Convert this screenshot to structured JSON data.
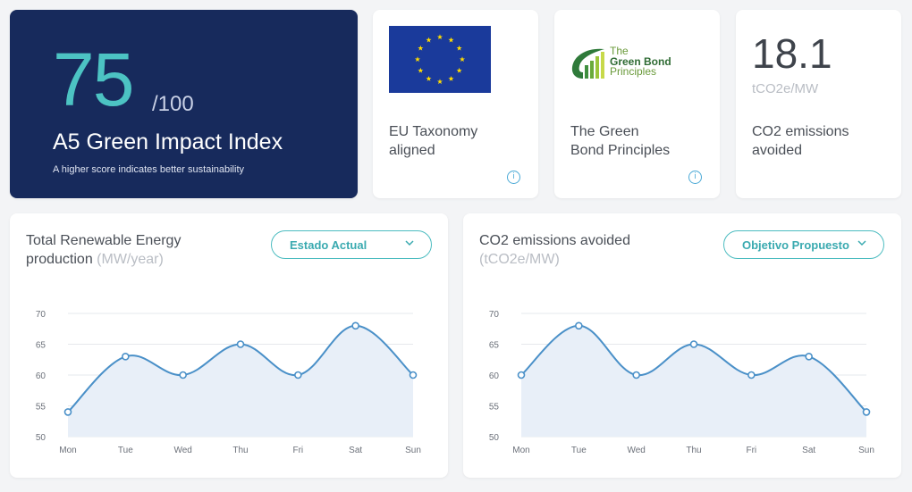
{
  "hero": {
    "score": "75",
    "out_of": "/100",
    "title": "A5 Green Impact Index",
    "subtitle": "A higher score indicates better sustainability",
    "colors": {
      "background": "#172a5c",
      "score": "#4cc3c3"
    }
  },
  "cards": {
    "eu_taxonomy": {
      "label_line1": "EU Taxonomy",
      "label_line2": "aligned",
      "icon": "eu-flag-icon",
      "info_icon": "info-icon"
    },
    "green_bond": {
      "logo_line1": "The",
      "logo_line2": "Green Bond",
      "logo_line3": "Principles",
      "label_line1": "The Green",
      "label_line2": "Bond Principles",
      "icon": "green-bond-logo",
      "info_icon": "info-icon"
    },
    "co2": {
      "value": "18.1",
      "unit": "tCO2e/MW",
      "label_line1": "CO2 emissions",
      "label_line2": "avoided"
    }
  },
  "charts": {
    "renewable": {
      "title_line1": "Total Renewable Energy",
      "title_line2": "production",
      "unit": "(MW/year)",
      "dropdown_label": "Estado Actual",
      "dropdown_icon": "chevron-down-icon"
    },
    "co2": {
      "title_line1": "CO2 emissions avoided",
      "unit": "(tCO2e/MW)",
      "dropdown_label": "Objetivo Propuesto",
      "dropdown_icon": "chevron-down-icon"
    }
  },
  "chart_data": [
    {
      "type": "area",
      "categories": [
        "Mon",
        "Tue",
        "Wed",
        "Thu",
        "Fri",
        "Sat",
        "Sun"
      ],
      "series": [
        {
          "values": [
            54,
            63,
            60,
            65,
            60,
            68,
            60
          ]
        }
      ],
      "ylim": [
        50,
        70
      ],
      "yticks": [
        "50",
        "55",
        "60",
        "65",
        "70"
      ],
      "grid": true,
      "colors": {
        "line": "#4a90c8",
        "fill": "#e8eff8"
      }
    },
    {
      "type": "area",
      "categories": [
        "Mon",
        "Tue",
        "Wed",
        "Thu",
        "Fri",
        "Sat",
        "Sun"
      ],
      "series": [
        {
          "values": [
            60,
            68,
            60,
            65,
            60,
            63,
            54
          ]
        }
      ],
      "ylim": [
        50,
        70
      ],
      "yticks": [
        "50",
        "55",
        "60",
        "65",
        "70"
      ],
      "grid": true,
      "colors": {
        "line": "#4a90c8",
        "fill": "#e8eff8"
      }
    }
  ]
}
